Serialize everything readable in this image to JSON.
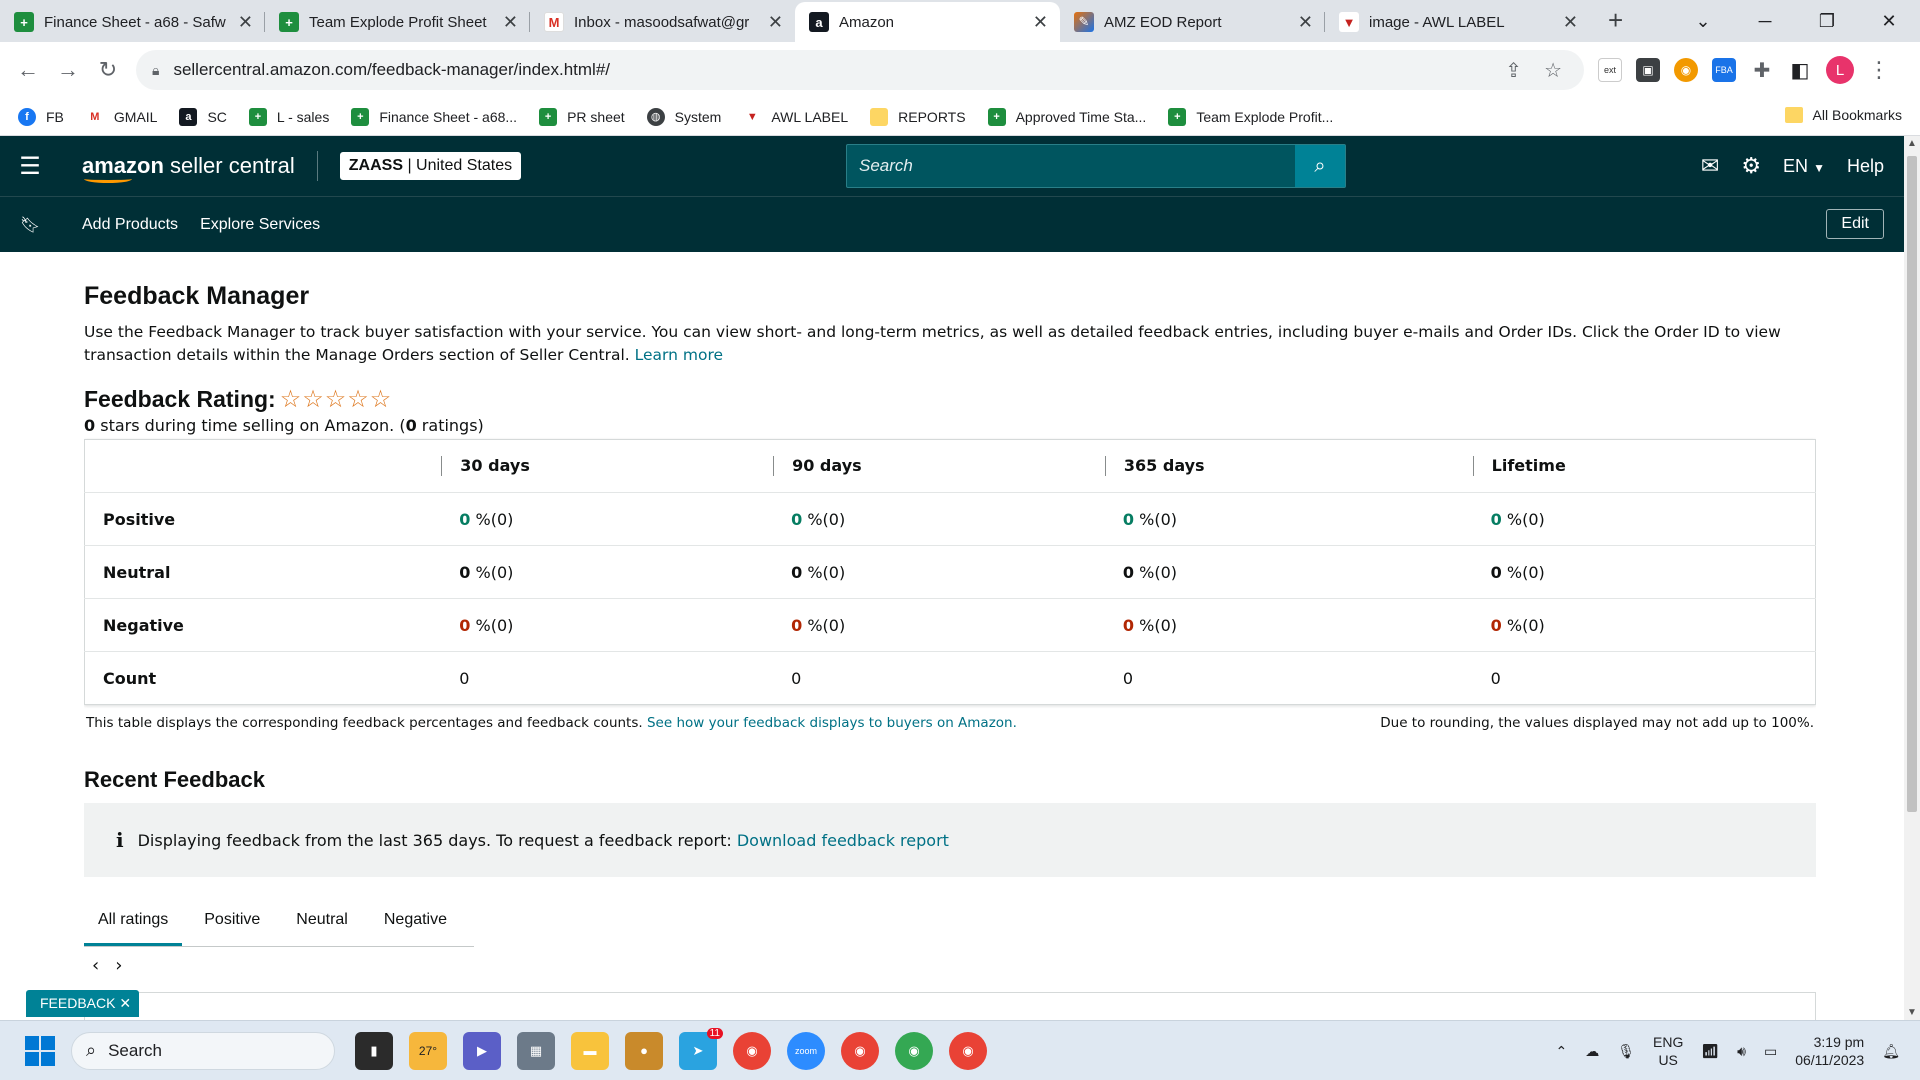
{
  "browser": {
    "tabs": [
      {
        "title": "Finance Sheet - a68 - Safw",
        "icon": "sheets-icon",
        "active": false
      },
      {
        "title": "Team Explode Profit Sheet",
        "icon": "sheets-icon",
        "active": false
      },
      {
        "title": "Inbox - masoodsafwat@gr",
        "icon": "gmail-icon",
        "active": false
      },
      {
        "title": "Amazon",
        "icon": "amazon-icon",
        "active": true
      },
      {
        "title": "AMZ EOD Report",
        "icon": "pen-icon",
        "active": false
      },
      {
        "title": "image - AWL LABEL",
        "icon": "awl-icon",
        "active": false
      }
    ],
    "url": "sellercentral.amazon.com/feedback-manager/index.html#/",
    "profile_initial": "L",
    "bookmarks": [
      {
        "label": "FB",
        "icon": "facebook-icon"
      },
      {
        "label": "GMAIL",
        "icon": "gmail-icon"
      },
      {
        "label": "SC",
        "icon": "amazon-icon"
      },
      {
        "label": "L - sales",
        "icon": "sheets-icon"
      },
      {
        "label": "Finance Sheet - a68...",
        "icon": "sheets-icon"
      },
      {
        "label": "PR sheet",
        "icon": "sheets-icon"
      },
      {
        "label": "System",
        "icon": "globe-icon"
      },
      {
        "label": "AWL LABEL",
        "icon": "awl-icon"
      },
      {
        "label": "REPORTS",
        "icon": "folder-icon"
      },
      {
        "label": "Approved Time Sta...",
        "icon": "sheets-icon"
      },
      {
        "label": "Team Explode Profit...",
        "icon": "sheets-icon"
      }
    ],
    "all_bookmarks": "All Bookmarks"
  },
  "header": {
    "logo_bold": "amazon",
    "logo_rest": " seller central",
    "account_store": "ZAASS",
    "account_region": " | United States",
    "search_placeholder": "Search",
    "language": "EN",
    "help": "Help"
  },
  "subnav": {
    "links": [
      "Add Products",
      "Explore Services"
    ],
    "edit": "Edit"
  },
  "page": {
    "title": "Feedback Manager",
    "intro": "Use the Feedback Manager to track buyer satisfaction with your service. You can view short- and long-term metrics, as well as detailed feedback entries, including buyer e-mails and Order IDs. Click the Order ID to view transaction details within the Manage Orders section of Seller Central.",
    "learn_more": "Learn more",
    "rating_label": "Feedback Rating:",
    "stars": "☆☆☆☆☆",
    "rating_stars": "0",
    "rating_mid": " stars during time selling on Amazon. (",
    "rating_count": "0",
    "rating_end": " ratings)"
  },
  "feedback_table": {
    "columns": [
      "30 days",
      "90 days",
      "365 days",
      "Lifetime"
    ],
    "rows": [
      {
        "label": "Positive",
        "cells": [
          {
            "n": "0",
            "p": " %(0)"
          },
          {
            "n": "0",
            "p": " %(0)"
          },
          {
            "n": "0",
            "p": " %(0)"
          },
          {
            "n": "0",
            "p": " %(0)"
          }
        ]
      },
      {
        "label": "Neutral",
        "cells": [
          {
            "n": "0",
            "p": " %(0)"
          },
          {
            "n": "0",
            "p": " %(0)"
          },
          {
            "n": "0",
            "p": " %(0)"
          },
          {
            "n": "0",
            "p": " %(0)"
          }
        ]
      },
      {
        "label": "Negative",
        "cells": [
          {
            "n": "0",
            "p": " %(0)"
          },
          {
            "n": "0",
            "p": " %(0)"
          },
          {
            "n": "0",
            "p": " %(0)"
          },
          {
            "n": "0",
            "p": " %(0)"
          }
        ]
      },
      {
        "label": "Count",
        "cells": [
          {
            "n": "0",
            "p": ""
          },
          {
            "n": "0",
            "p": ""
          },
          {
            "n": "0",
            "p": ""
          },
          {
            "n": "0",
            "p": ""
          }
        ]
      }
    ],
    "note": "This table displays the corresponding feedback percentages and feedback counts.",
    "note_link": "See how your feedback displays to buyers on Amazon.",
    "rounding_note": "Due to rounding, the values displayed may not add up to 100%."
  },
  "recent": {
    "title": "Recent Feedback",
    "info_text": "Displaying feedback from the last 365 days. To request a feedback report:",
    "info_link": "Download feedback report",
    "tabs": [
      "All ratings",
      "Positive",
      "Neutral",
      "Negative"
    ],
    "active_tab": "All ratings"
  },
  "feedback_button": "FEEDBACK ✕",
  "taskbar": {
    "search": "Search",
    "weather": "27°",
    "telegram_badge": "11",
    "language": "ENG",
    "region": "US",
    "time": "3:19 pm",
    "date": "06/11/2023"
  },
  "colors": {
    "header_bg": "#002f36",
    "link": "#007185",
    "positive": "#067d62",
    "negative": "#b12704",
    "accent": "#008296"
  }
}
